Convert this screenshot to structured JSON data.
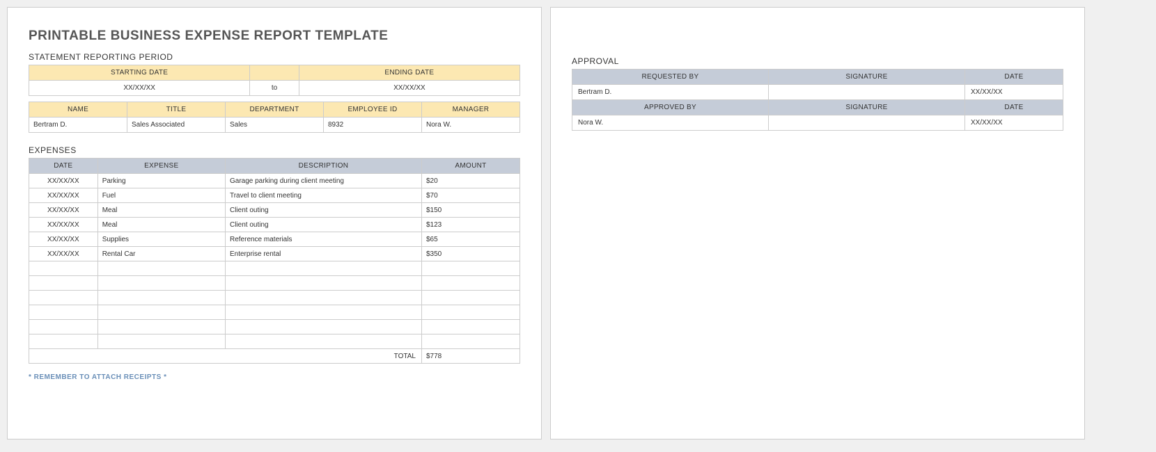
{
  "title": "PRINTABLE BUSINESS EXPENSE REPORT TEMPLATE",
  "period": {
    "section_title": "STATEMENT REPORTING PERIOD",
    "start_header": "STARTING DATE",
    "end_header": "ENDING DATE",
    "start_value": "XX/XX/XX",
    "separator": "to",
    "end_value": "XX/XX/XX"
  },
  "employee": {
    "headers": {
      "name": "NAME",
      "title": "TITLE",
      "department": "DEPARTMENT",
      "employee_id": "EMPLOYEE ID",
      "manager": "MANAGER"
    },
    "values": {
      "name": "Bertram D.",
      "title": "Sales Associated",
      "department": "Sales",
      "employee_id": "8932",
      "manager": "Nora W."
    }
  },
  "expenses": {
    "section_title": "EXPENSES",
    "headers": {
      "date": "DATE",
      "expense": "EXPENSE",
      "description": "DESCRIPTION",
      "amount": "AMOUNT"
    },
    "rows": [
      {
        "date": "XX/XX/XX",
        "expense": "Parking",
        "description": "Garage parking during client meeting",
        "amount": "$20"
      },
      {
        "date": "XX/XX/XX",
        "expense": "Fuel",
        "description": "Travel to client meeting",
        "amount": "$70"
      },
      {
        "date": "XX/XX/XX",
        "expense": "Meal",
        "description": "Client outing",
        "amount": "$150"
      },
      {
        "date": "XX/XX/XX",
        "expense": "Meal",
        "description": "Client outing",
        "amount": "$123"
      },
      {
        "date": "XX/XX/XX",
        "expense": "Supplies",
        "description": "Reference materials",
        "amount": "$65"
      },
      {
        "date": "XX/XX/XX",
        "expense": "Rental Car",
        "description": "Enterprise rental",
        "amount": "$350"
      },
      {
        "date": "",
        "expense": "",
        "description": "",
        "amount": ""
      },
      {
        "date": "",
        "expense": "",
        "description": "",
        "amount": ""
      },
      {
        "date": "",
        "expense": "",
        "description": "",
        "amount": ""
      },
      {
        "date": "",
        "expense": "",
        "description": "",
        "amount": ""
      },
      {
        "date": "",
        "expense": "",
        "description": "",
        "amount": ""
      },
      {
        "date": "",
        "expense": "",
        "description": "",
        "amount": ""
      }
    ],
    "total_label": "TOTAL",
    "total_value": "$778"
  },
  "reminder": "* REMEMBER TO ATTACH RECEIPTS *",
  "approval": {
    "section_title": "APPROVAL",
    "headers": {
      "requested_by": "REQUESTED BY",
      "approved_by": "APPROVED BY",
      "signature": "SIGNATURE",
      "date": "DATE"
    },
    "requested": {
      "name": "Bertram D.",
      "signature": "",
      "date": "XX/XX/XX"
    },
    "approved": {
      "name": "Nora W.",
      "signature": "",
      "date": "XX/XX/XX"
    }
  }
}
